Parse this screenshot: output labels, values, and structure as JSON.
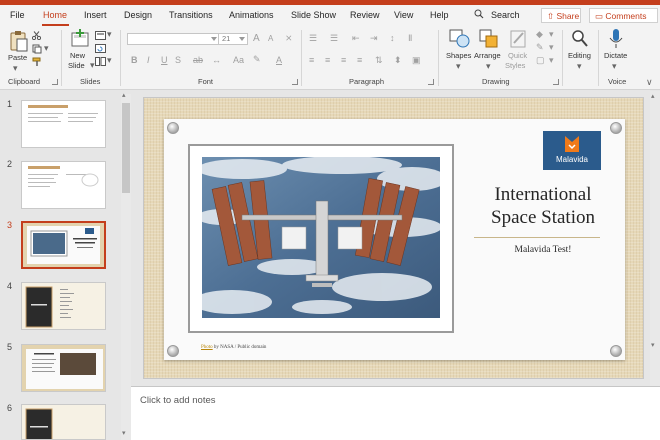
{
  "app": {
    "accent": "#c43e1c"
  },
  "tabs": [
    {
      "label": "File"
    },
    {
      "label": "Home",
      "active": true
    },
    {
      "label": "Insert"
    },
    {
      "label": "Design"
    },
    {
      "label": "Transitions"
    },
    {
      "label": "Animations"
    },
    {
      "label": "Slide Show"
    },
    {
      "label": "Review"
    },
    {
      "label": "View"
    },
    {
      "label": "Help"
    }
  ],
  "search": {
    "label": "Search"
  },
  "actions": {
    "share": "Share",
    "comments": "Comments"
  },
  "ribbon": {
    "clipboard": {
      "label": "Clipboard",
      "paste": "Paste"
    },
    "slides": {
      "label": "Slides",
      "new_slide_1": "New",
      "new_slide_2": "Slide"
    },
    "font": {
      "label": "Font",
      "font_name": "",
      "font_size": "21",
      "bold": "B",
      "italic": "I",
      "underline": "U",
      "strike": "S",
      "grow": "A",
      "shrink": "A",
      "font_color": "A"
    },
    "paragraph": {
      "label": "Paragraph"
    },
    "drawing": {
      "label": "Drawing",
      "shapes": "Shapes",
      "arrange": "Arrange",
      "quick_styles_1": "Quick",
      "quick_styles_2": "Styles"
    },
    "editing": {
      "label": "Editing"
    },
    "voice": {
      "label": "Voice",
      "dictate": "Dictate"
    }
  },
  "thumbnails": [
    {
      "number": "1"
    },
    {
      "number": "2"
    },
    {
      "number": "3",
      "selected": true
    },
    {
      "number": "4"
    },
    {
      "number": "5"
    },
    {
      "number": "6"
    }
  ],
  "slide": {
    "logo_text": "Malavida",
    "title_line1": "International",
    "title_line2": "Space Station",
    "subtitle": "Malavida Test!",
    "credit_link": "Photo",
    "credit_rest": " by NASA / Public domain"
  },
  "thumb_text": {
    "t3_title": "International Space Station",
    "t4_title": "Disclaimer",
    "t6_title": "Conclusion"
  },
  "notes": {
    "placeholder": "Click to add notes"
  }
}
